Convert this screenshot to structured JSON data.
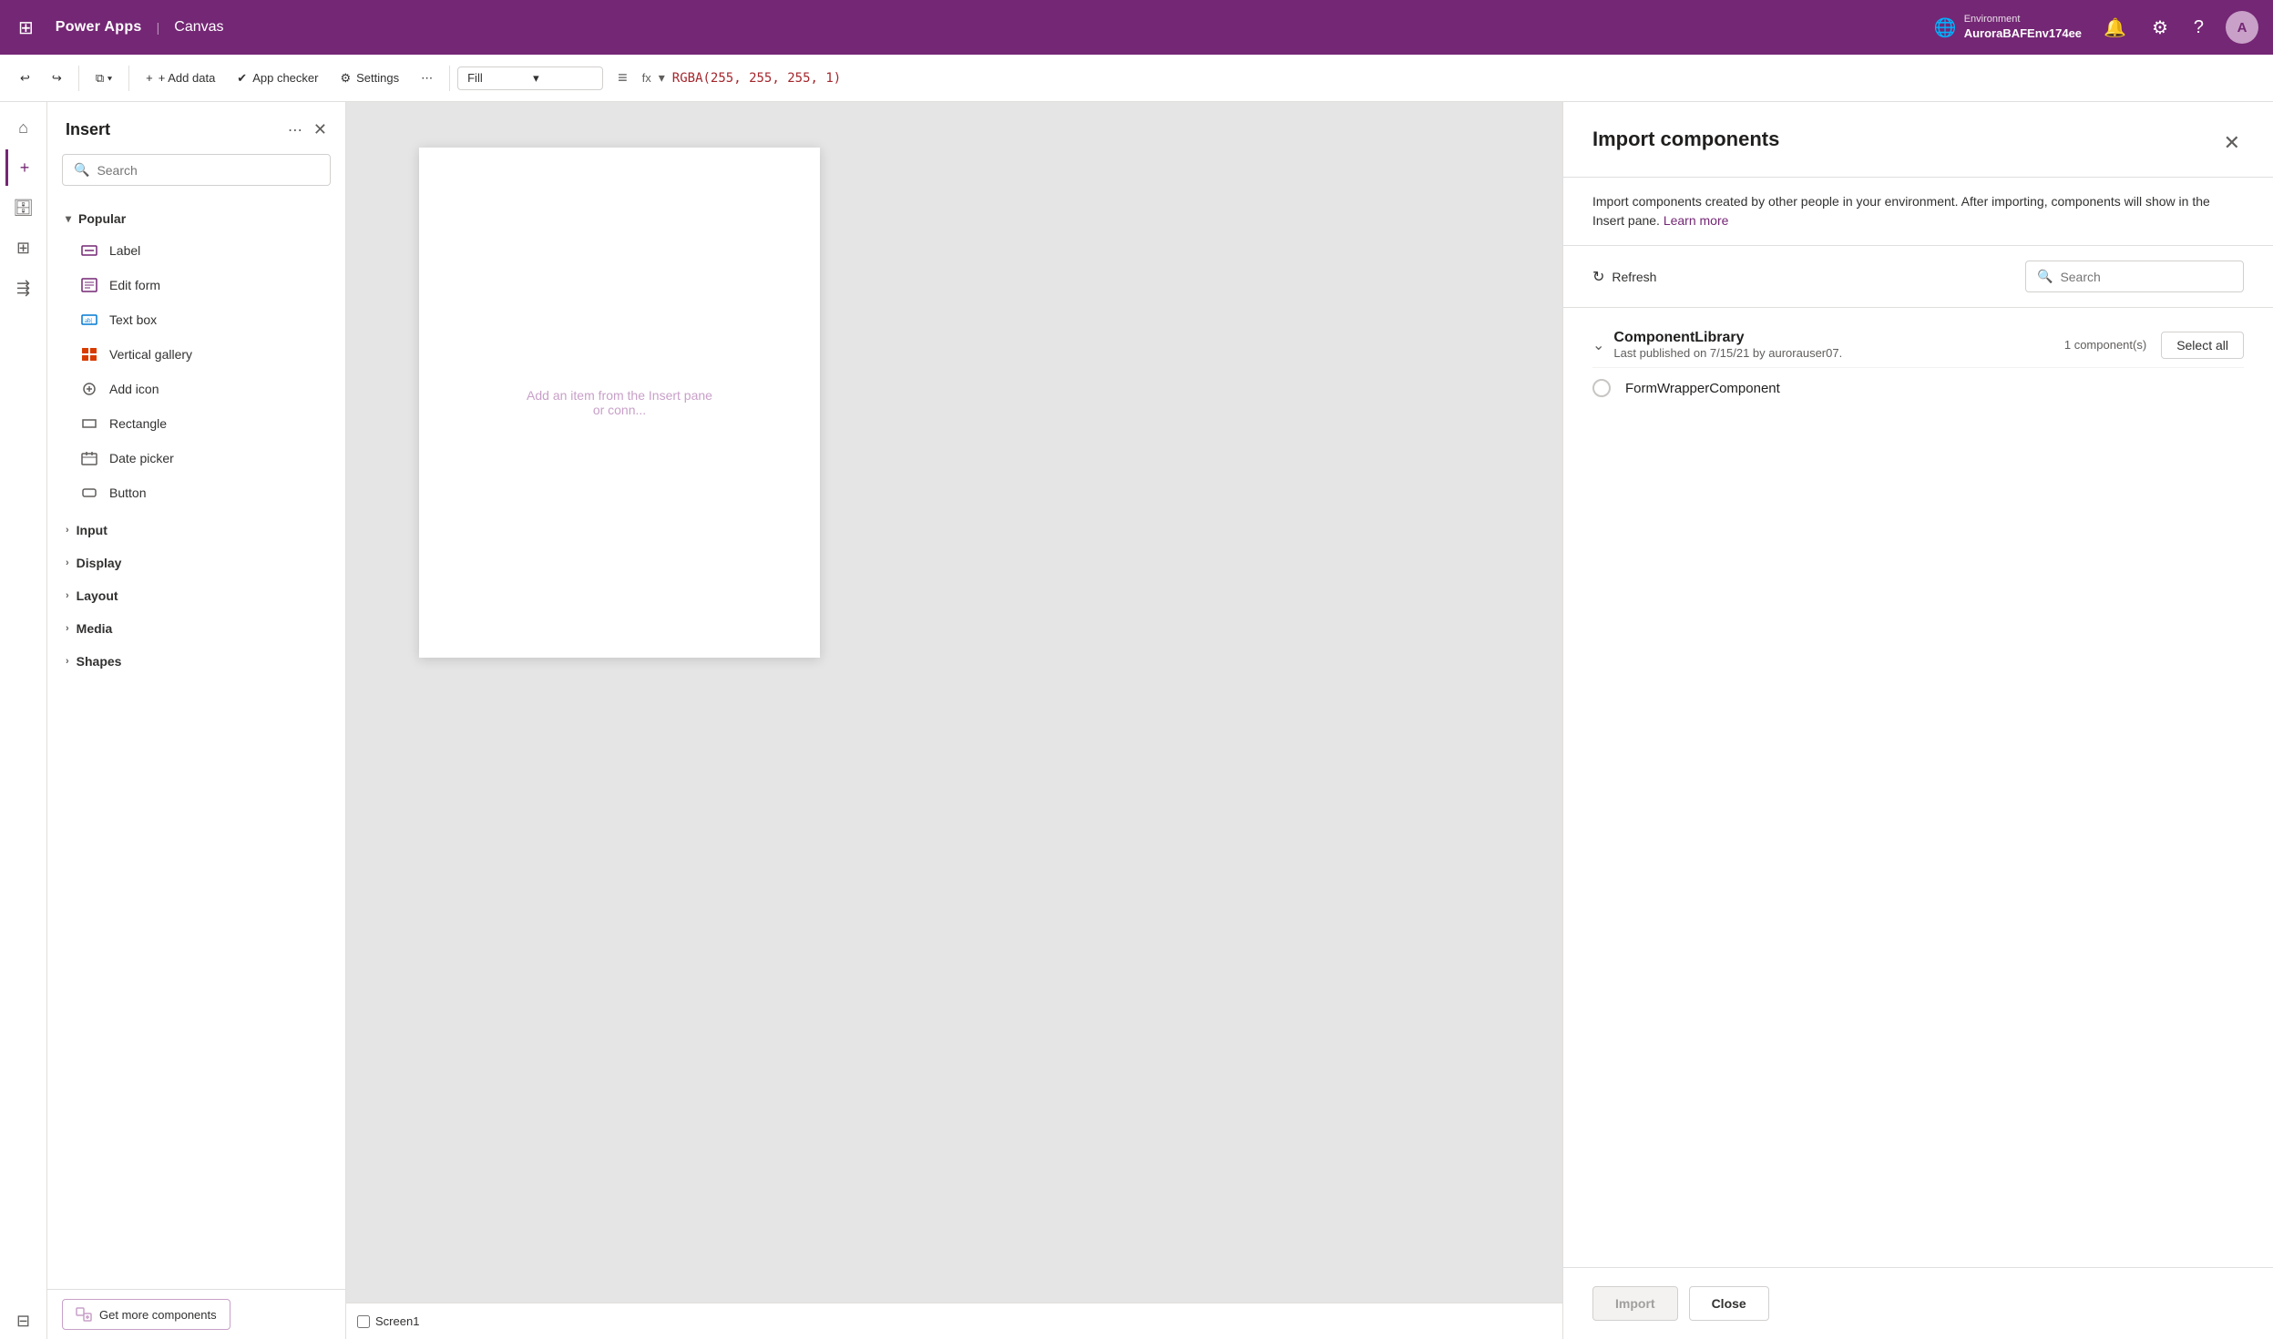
{
  "topbar": {
    "grid_icon": "⊞",
    "brand": "Power Apps",
    "separator": "|",
    "canvas": "Canvas",
    "env_label": "Environment",
    "env_name": "AuroraBAFEnv174ee",
    "bell_icon": "🔔",
    "gear_icon": "⚙",
    "help_icon": "?",
    "avatar_letter": "A"
  },
  "toolbar": {
    "undo_icon": "↩",
    "redo_icon": "↪",
    "copy_icon": "⧉",
    "add_data_label": "+ Add data",
    "app_checker_label": "App checker",
    "settings_label": "Settings",
    "more_icon": "⋯",
    "fill_label": "Fill",
    "formula_label": "fx",
    "formula_equals": "=",
    "formula_value": "RGBA(255, 255, 255, 1)"
  },
  "insert_panel": {
    "title": "Insert",
    "search_placeholder": "Search",
    "popular_label": "Popular",
    "items": [
      {
        "icon": "🏷",
        "label": "Label",
        "icon_class": "icon-label"
      },
      {
        "icon": "📝",
        "label": "Edit form",
        "icon_class": "icon-edit-form"
      },
      {
        "icon": "📋",
        "label": "Text box",
        "icon_class": "icon-textbox"
      },
      {
        "icon": "▦",
        "label": "Vertical gallery",
        "icon_class": "icon-gallery-item"
      },
      {
        "icon": "+",
        "label": "Add icon",
        "icon_class": "icon-add"
      },
      {
        "icon": "▭",
        "label": "Rectangle",
        "icon_class": "icon-rect-item"
      },
      {
        "icon": "📅",
        "label": "Date picker",
        "icon_class": "icon-date"
      },
      {
        "icon": "🔲",
        "label": "Button",
        "icon_class": "icon-button-item"
      }
    ],
    "categories": [
      {
        "label": "Input"
      },
      {
        "label": "Display"
      },
      {
        "label": "Layout"
      },
      {
        "label": "Media"
      },
      {
        "label": "Shapes"
      }
    ],
    "get_more_label": "Get more components"
  },
  "canvas": {
    "hint": "Add an item from the Insert pane or conn...",
    "screen_label": "Screen1"
  },
  "import_panel": {
    "title": "Import components",
    "close_icon": "✕",
    "description": "Import components created by other people in your environment. After importing, components will show in the Insert pane.",
    "learn_more_label": "Learn more",
    "refresh_label": "Refresh",
    "search_placeholder": "Search",
    "library": {
      "name": "ComponentLibrary",
      "meta": "Last published on 7/15/21 by aurorauser07.",
      "count": "1 component(s)",
      "select_all_label": "Select all",
      "components": [
        {
          "name": "FormWrapperComponent"
        }
      ]
    },
    "import_label": "Import",
    "close_label": "Close"
  }
}
